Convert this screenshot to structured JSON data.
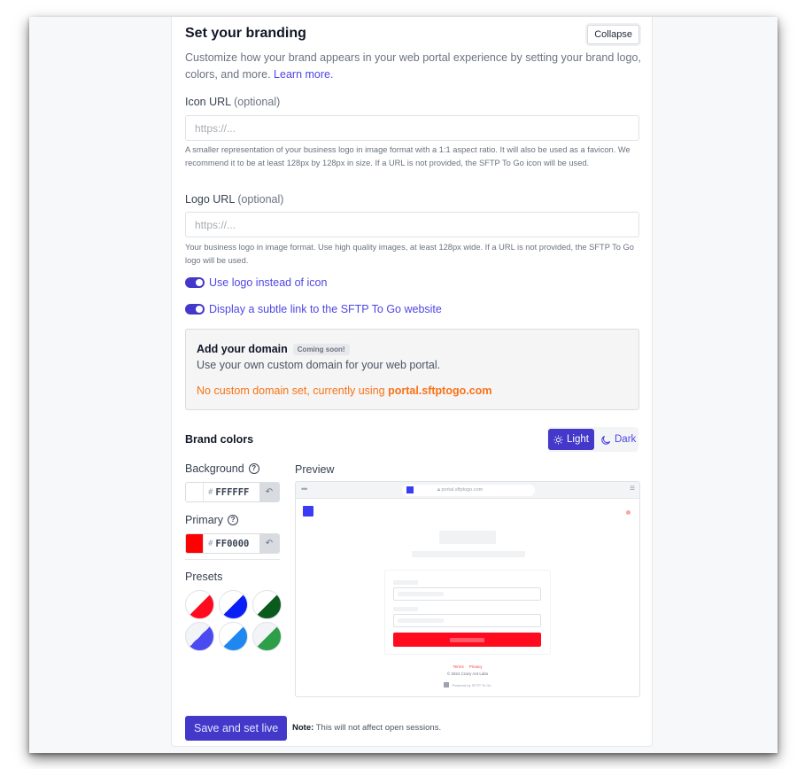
{
  "card": {
    "title": "Set your branding",
    "collapse_label": "Collapse",
    "description": "Customize how your brand appears in your web portal experience by setting your brand logo, colors, and more. ",
    "learn_more_label": "Learn more."
  },
  "icon_url": {
    "label": "Icon URL",
    "optional": "(optional)",
    "value": "",
    "placeholder": "https://...",
    "help": "A smaller representation of your business logo in image format with a 1:1 aspect ratio. It will also be used as a favicon. We recommend it to be at least 128px by 128px in size. If a URL is not provided, the SFTP To Go icon will be used."
  },
  "logo_url": {
    "label": "Logo URL",
    "optional": "(optional)",
    "value": "",
    "placeholder": "https://...",
    "help": "Your business logo in image format. Use high quality images, at least 128px wide. If a URL is not provided, the SFTP To Go logo will be used."
  },
  "toggles": [
    {
      "label": "Use logo instead of icon",
      "checked": true
    },
    {
      "label": "Display a subtle link to the SFTP To Go website",
      "checked": true
    }
  ],
  "domain": {
    "title": "Add your domain",
    "badge": "Coming soon!",
    "description": "Use your own custom domain for your web portal.",
    "status_prefix": "No custom domain set, currently using ",
    "current_domain": "portal.sftptogo.com"
  },
  "brand_colors": {
    "title": "Brand colors",
    "modes": [
      {
        "label": "Light",
        "icon": "sun-icon",
        "active": true
      },
      {
        "label": "Dark",
        "icon": "moon-icon",
        "active": false
      }
    ],
    "background": {
      "label": "Background",
      "hash": "#",
      "value": "FFFFFF",
      "color": "#FFFFFF"
    },
    "primary": {
      "label": "Primary",
      "hash": "#",
      "value": "FF0000",
      "color": "#FF0000"
    },
    "presets_label": "Presets",
    "presets": [
      {
        "bg": "#FFFFFF",
        "primary": "#FF0A1F"
      },
      {
        "bg": "#FFFFFF",
        "primary": "#0A1FF5"
      },
      {
        "bg": "#FFFFFF",
        "primary": "#0B5A1E"
      },
      {
        "bg": "#F3F4F8",
        "primary": "#4A4AF0"
      },
      {
        "bg": "#FFFFFF",
        "primary": "#1E88F0"
      },
      {
        "bg": "#F3F4F8",
        "primary": "#2E9E48"
      }
    ]
  },
  "preview": {
    "label": "Preview",
    "dots": "•••",
    "address": "portal.sftptogo.com",
    "menu_icon": "≡",
    "links": [
      "Terms",
      "Privacy"
    ],
    "copyright": "© 2024 Crazy Ant Labs",
    "powered": "Powered by SFTP To Go"
  },
  "footer": {
    "save_label": "Save and set live",
    "note_bold": "Note:",
    "note_text": " This will not affect open sessions."
  }
}
